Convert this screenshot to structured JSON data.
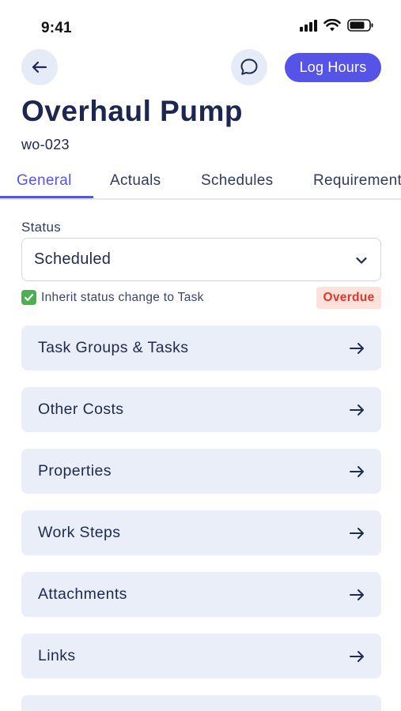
{
  "status_bar": {
    "time": "9:41"
  },
  "header": {
    "log_hours_label": "Log Hours",
    "title": "Overhaul Pump",
    "work_order_id": "wo-023"
  },
  "tabs": [
    {
      "label": "General",
      "active": true
    },
    {
      "label": "Actuals",
      "active": false
    },
    {
      "label": "Schedules",
      "active": false
    },
    {
      "label": "Requirements",
      "active": false
    }
  ],
  "status_field": {
    "label": "Status",
    "value": "Scheduled",
    "inherit_label": "Inherit status change to Task",
    "inherit_checked": true,
    "badge": "Overdue"
  },
  "sections": [
    {
      "label": "Task Groups & Tasks"
    },
    {
      "label": "Other Costs"
    },
    {
      "label": "Properties"
    },
    {
      "label": "Work Steps"
    },
    {
      "label": "Attachments"
    },
    {
      "label": "Links"
    },
    {
      "label": ""
    }
  ],
  "colors": {
    "accent": "#5654e8",
    "card_bg": "#e9eef9",
    "title": "#1c2650",
    "overdue_bg": "#fde2dc",
    "overdue_text": "#e0352b",
    "check": "#4caf50"
  }
}
